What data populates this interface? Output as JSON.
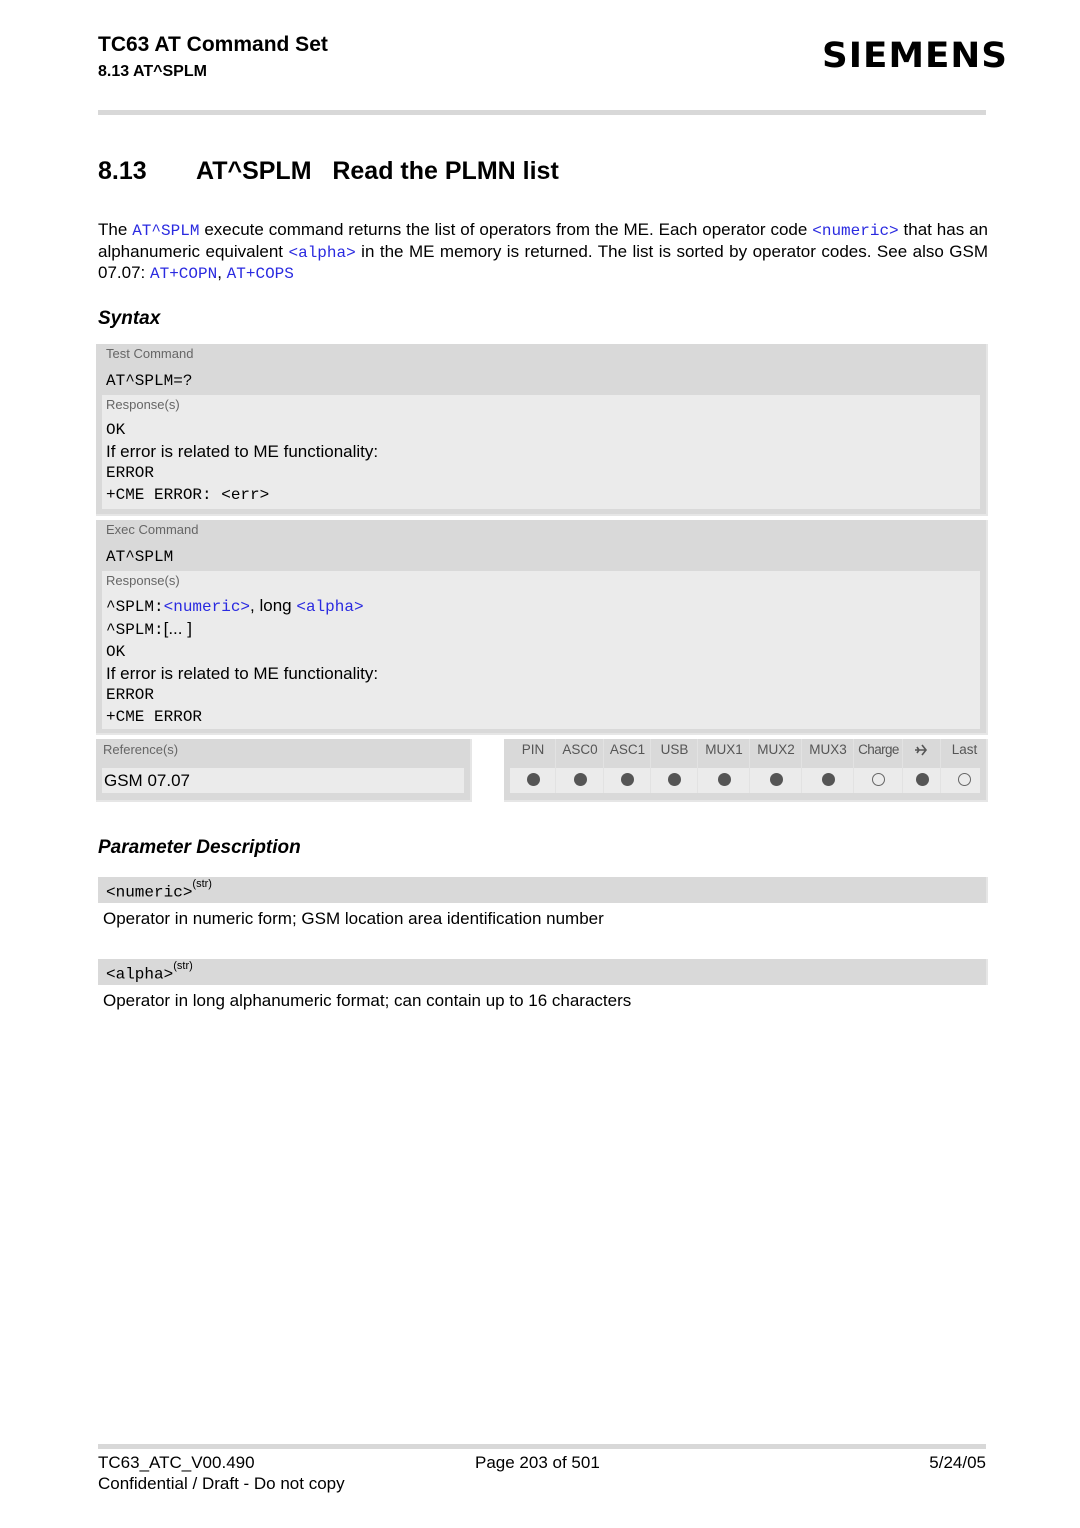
{
  "header": {
    "doc_title": "TC63 AT Command Set",
    "section_ref": "8.13 AT^SPLM",
    "logo": "SIEMENS"
  },
  "section": {
    "number": "8.13",
    "title": "AT^SPLM   Read the PLMN list"
  },
  "intro": {
    "p1_a": "The ",
    "p1_link_cmd": "AT^SPLM",
    "p1_b": " execute command returns the list of operators from the ME. Each operator code ",
    "p1_link_numeric": "<numeric>",
    "p1_c": " that has an alphanumeric equivalent ",
    "p1_link_alpha": "<alpha>",
    "p1_d": " in the ME memory is returned. The list is sorted by operator codes. See also GSM 07.07: ",
    "p1_link_copn": "AT+COPN",
    "p1_sep": ", ",
    "p1_link_cops": "AT+COPS"
  },
  "syntax": {
    "heading": "Syntax",
    "test": {
      "label": "Test Command",
      "command": "AT^SPLM=?",
      "responses_label": "Response(s)",
      "lines": [
        "OK",
        "If error is related to ME functionality:",
        "ERROR",
        "+CME ERROR: <err>"
      ]
    },
    "exec": {
      "label": "Exec Command",
      "command": "AT^SPLM",
      "responses_label": "Response(s)",
      "line1_prefix": "^SPLM:",
      "line1_numeric": "<numeric>",
      "line1_mid": ", long ",
      "line1_alpha": "<alpha>",
      "line2_prefix": "^SPLM:",
      "line2_rest": "[... ]",
      "lines": [
        "OK",
        "If error is related to ME functionality:",
        "ERROR",
        "+CME ERROR"
      ]
    },
    "reference": {
      "label": "Reference(s)",
      "value": "GSM 07.07"
    },
    "properties": [
      {
        "name": "PIN",
        "state": "filled"
      },
      {
        "name": "ASC0",
        "state": "filled"
      },
      {
        "name": "ASC1",
        "state": "filled"
      },
      {
        "name": "USB",
        "state": "filled"
      },
      {
        "name": "MUX1",
        "state": "filled"
      },
      {
        "name": "MUX2",
        "state": "filled"
      },
      {
        "name": "MUX3",
        "state": "filled"
      },
      {
        "name": "Charge",
        "state": "empty"
      },
      {
        "name": "airplane-icon",
        "state": "filled"
      },
      {
        "name": "Last",
        "state": "empty"
      }
    ]
  },
  "parameters": {
    "heading": "Parameter Description",
    "items": [
      {
        "name": "<numeric>",
        "type": "(str)",
        "description": "Operator in numeric form; GSM location area identification number"
      },
      {
        "name": "<alpha>",
        "type": "(str)",
        "description": "Operator in long alphanumeric format; can contain up to 16 characters"
      }
    ]
  },
  "footer": {
    "doc_id": "TC63_ATC_V00.490",
    "page": "Page 203 of 501",
    "date": "5/24/05",
    "confidential": "Confidential / Draft - Do not copy"
  }
}
